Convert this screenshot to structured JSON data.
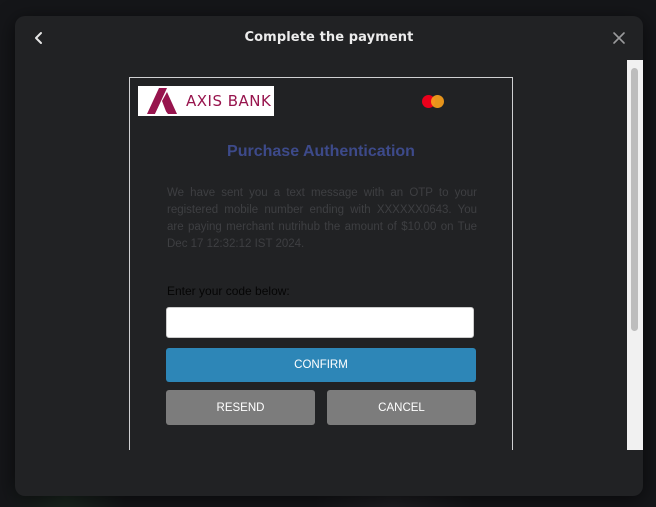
{
  "modal": {
    "title": "Complete the payment",
    "back_icon": "chevron-left-icon",
    "close_icon": "close-icon"
  },
  "bank_page": {
    "bank_logo_text": "AXIS BANK",
    "card_network_icon": "mastercard-logo",
    "heading": "Purchase Authentication",
    "info_message": "We have sent you a text message with an OTP to your registered mobile number ending with XXXXXX0643. You are paying merchant nutrihub the amount of $10.00 on Tue Dec 17 12:32:12 IST 2024.",
    "code_label": "Enter your code below:",
    "otp_value": "",
    "otp_placeholder": "",
    "confirm_label": "CONFIRM",
    "resend_label": "RESEND",
    "cancel_label": "CANCEL"
  },
  "colors": {
    "modal_bg": "#212224",
    "heading": "#3d4a8a",
    "confirm_button": "#2d86b7",
    "secondary_button": "#7c7c7c",
    "brand": "#97144d"
  }
}
